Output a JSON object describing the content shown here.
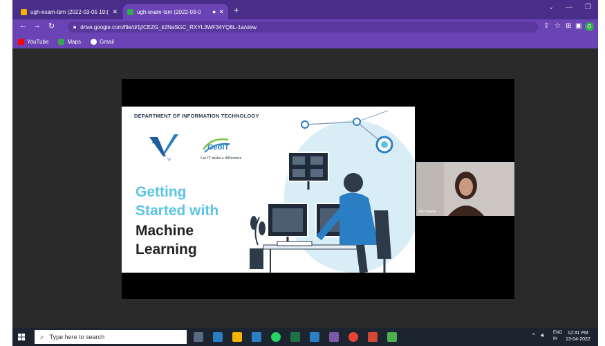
{
  "browser": {
    "tabs": [
      {
        "title": "ugh-exam-tsm (2022-03-05 19:(",
        "active": false
      },
      {
        "title": "ugh-exam-tsm (2022-03-0",
        "active": true
      }
    ],
    "url": "drive.google.com/file/d/1jICEZG_k2NaSGC_RXYL3WF34YQ6L-1a/view",
    "bookmarks": [
      {
        "label": "YouTube",
        "color": "#ff0000"
      },
      {
        "label": "Maps",
        "color": "#34a853"
      },
      {
        "label": "Gmail",
        "color": "#ea4335"
      }
    ]
  },
  "slide": {
    "department": "DEPARTMENT OF INFORMATION TECHNOLOGY",
    "logo_text": "GedIT",
    "tagline": "Let IT make a difference",
    "title_line1": "Getting",
    "title_line2": "Started with",
    "title_line3": "Machine",
    "title_line4": "Learning"
  },
  "camera": {
    "name": "Jimi Seyma"
  },
  "taskbar": {
    "search_placeholder": "Type here to search",
    "language": "ENG",
    "region": "IN",
    "time": "12:31 PM",
    "date": "13-04-2022"
  },
  "colors": {
    "browser_frame": "#4a2d88",
    "browser_toolbar": "#6a44b4",
    "title_accent": "#5bc4e6",
    "taskbar": "#1c2430"
  }
}
